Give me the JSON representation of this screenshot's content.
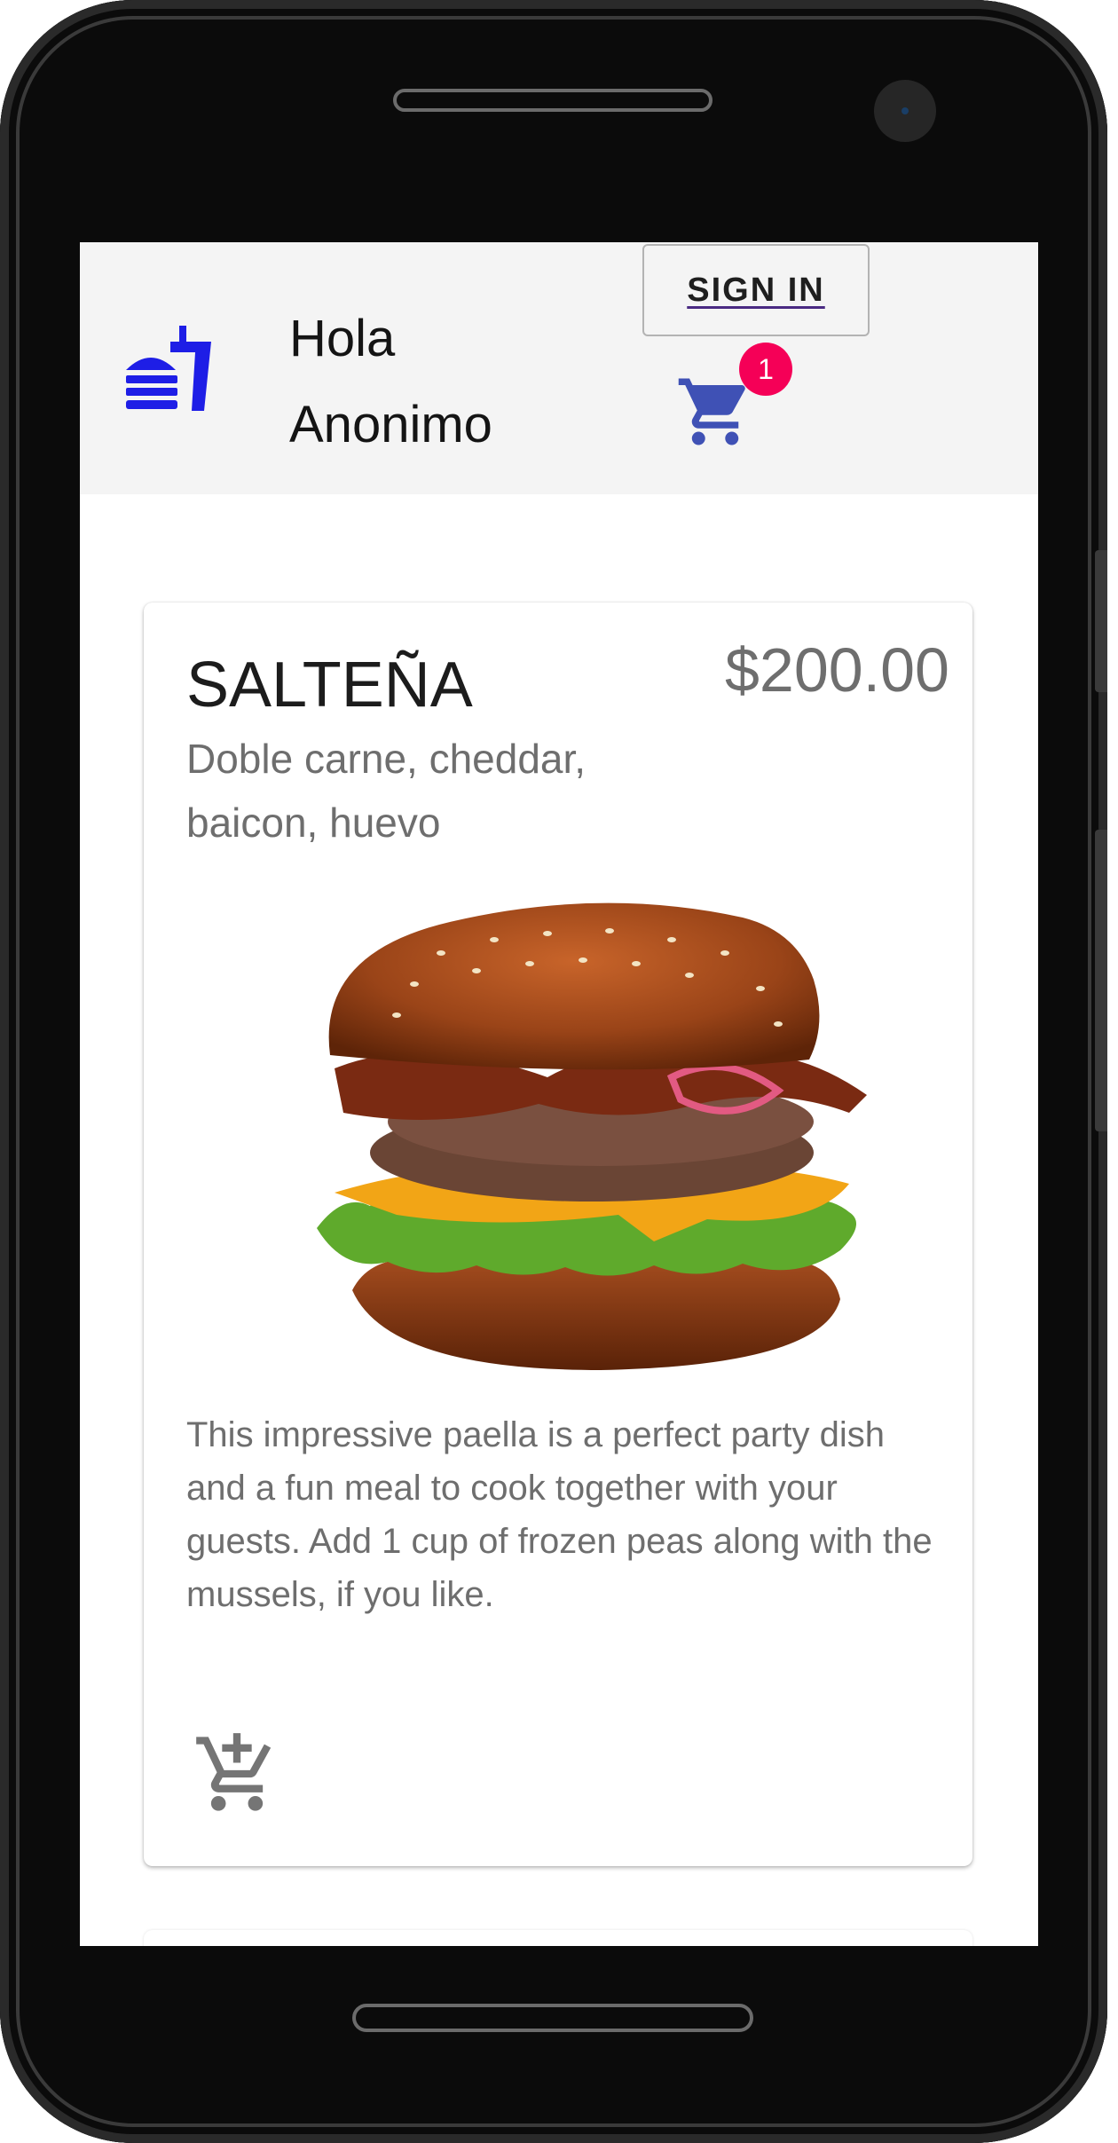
{
  "header": {
    "logo_icon": "fastfood-icon",
    "greeting_line1": "Hola",
    "greeting_line2": "Anonimo",
    "signin_label": "SIGN IN",
    "cart_icon": "shopping-cart-icon",
    "cart_count": "1",
    "accent_color": "#1e1ee6",
    "cart_color": "#3f51b5",
    "badge_color": "#f50057"
  },
  "product": {
    "name": "SALTEÑA",
    "price": "$200.00",
    "subtitle": "Doble carne, cheddar, baicon, huevo",
    "image": "burger-photo",
    "description": "This impressive paella is a perfect party dish and a fun meal to cook together with your guests. Add 1 cup of frozen peas along with the mussels, if you like.",
    "action_icon": "add-shopping-cart-icon"
  }
}
